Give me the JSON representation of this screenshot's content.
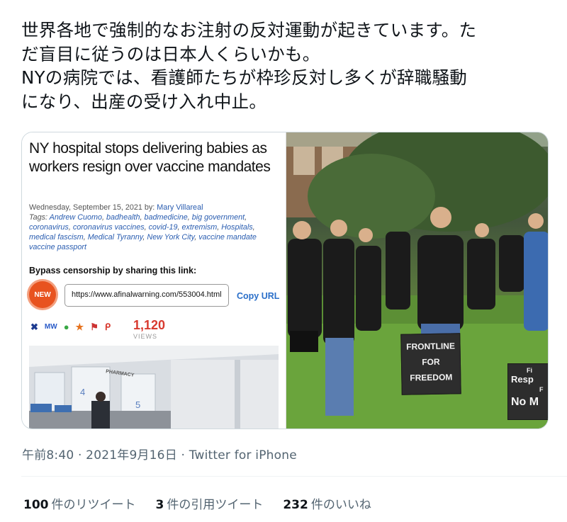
{
  "tweet": {
    "lines": [
      "世界各地で強制的なお注射の反対運動が起きています。た",
      "だ盲目に従うのは日本人くらいかも。",
      "NYの病院では、看護師たちが枠珍反対し多くが辞職騒動",
      "になり、出産の受け入れ中止。"
    ]
  },
  "article": {
    "headline": "NY hospital stops delivering babies as workers resign over vaccine mandates",
    "date": "Wednesday, September 15, 2021 by:",
    "author": "Mary Villareal",
    "tags_label": "Tags:",
    "tags": [
      "Andrew Cuomo",
      "badhealth",
      "badmedicine",
      "big government",
      "coronavirus",
      "coronavirus vaccines",
      "covid-19",
      "extremism",
      "Hospitals",
      "medical fascism",
      "Medical Tyranny",
      "New York City",
      "vaccine mandate",
      "vaccine passport"
    ],
    "bypass_label": "Bypass censorship by sharing this link:",
    "new_badge": "NEW",
    "url": "https://www.afinalwarning.com/553004.html",
    "copy_url": "Copy URL",
    "views_count": "1,120",
    "views_label": "VIEWS",
    "pharmacy_sign": "PHARMACY",
    "counter_numbers": [
      "4",
      "5"
    ]
  },
  "photo": {
    "sign1_lines": [
      "FRONTLINE",
      "FOR",
      "FREEDOM"
    ],
    "sign2_lines": [
      "Fi",
      "Resp",
      "F",
      "No M"
    ]
  },
  "meta": {
    "timestamp": "午前8:40 · 2021年9月16日 · Twitter for iPhone"
  },
  "stats": {
    "retweets_count": "100",
    "retweets_label": "件のリツイート",
    "quotes_count": "3",
    "quotes_label": "件の引用ツイート",
    "likes_count": "232",
    "likes_label": "件のいいね"
  }
}
